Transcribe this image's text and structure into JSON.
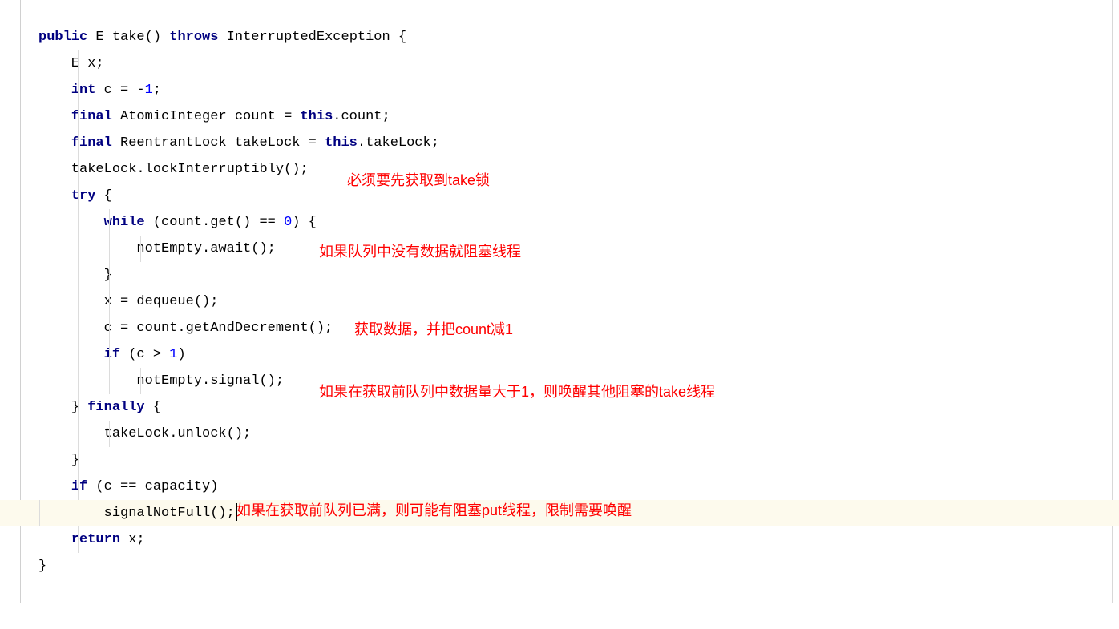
{
  "keywords": {
    "public": "public",
    "throws": "throws",
    "int": "int",
    "final": "final",
    "this": "this",
    "try": "try",
    "while": "while",
    "if": "if",
    "finally": "finally",
    "return": "return"
  },
  "code": {
    "l1_a": " E take() ",
    "l1_b": " InterruptedException {",
    "l2": "    E x;",
    "l3_a": " c = -",
    "l3_b": ";",
    "l3_num": "1",
    "l4_a": " AtomicInteger count = ",
    "l4_b": ".count;",
    "l5_a": " ReentrantLock takeLock = ",
    "l5_b": ".takeLock;",
    "l6": "    takeLock.lockInterruptibly();",
    "l7": " {",
    "l8_a": " (count.get() == ",
    "l8_b": ") {",
    "l8_num": "0",
    "l9": "            notEmpty.await();",
    "l10": "        }",
    "l11": "        x = dequeue();",
    "l12": "        c = count.getAndDecrement();",
    "l13_a": " (c > ",
    "l13_b": ")",
    "l13_num": "1",
    "l14": "            notEmpty.signal();",
    "l15_a": "    } ",
    "l15_b": " {",
    "l16": "        takeLock.unlock();",
    "l17": "    }",
    "l18_a": " (c == capacity)",
    "l19": "        signalNotFull();",
    "l20_a": " x;",
    "l21": "}"
  },
  "annotations": {
    "a1": "必须要先获取到take锁",
    "a2": "如果队列中没有数据就阻塞线程",
    "a3": "获取数据，并把count减1",
    "a4": "如果在获取前队列中数据量大于1，则唤醒其他阻塞的take线程",
    "a5": "如果在获取前队列已满，则可能有阻塞put线程，限制需要唤醒"
  }
}
